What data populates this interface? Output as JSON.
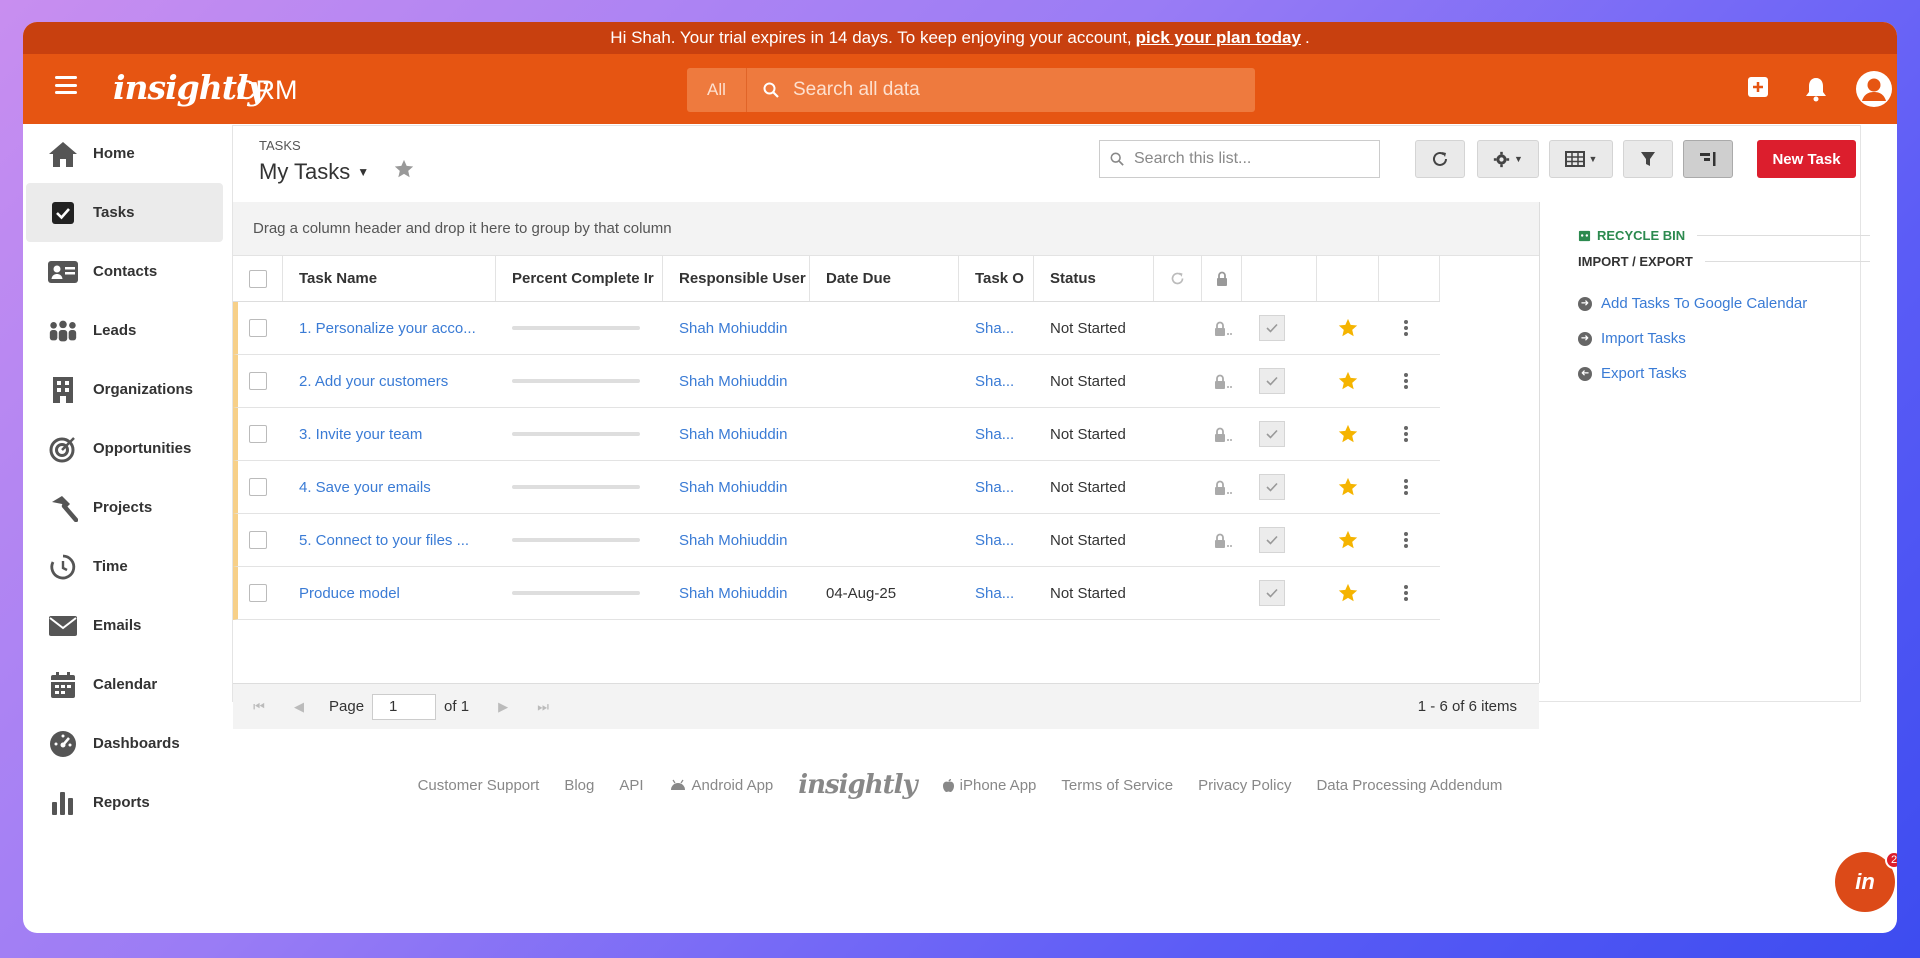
{
  "trial_banner": {
    "text": "Hi Shah. Your trial expires in 14 days. To keep enjoying your account,",
    "link": "pick your plan today",
    "suffix": "."
  },
  "topbar": {
    "logo": "insightly",
    "product": "CRM",
    "search_scope": "All",
    "search_placeholder": "Search all data",
    "icons": [
      "menu-icon",
      "add-icon",
      "bell-icon",
      "user-avatar-icon"
    ],
    "brand_color": "#e65512"
  },
  "sidebar": {
    "items": [
      {
        "label": "Home",
        "icon": "home-icon"
      },
      {
        "label": "Tasks",
        "icon": "checkbox-icon",
        "active": true
      },
      {
        "label": "Contacts",
        "icon": "contact-card-icon"
      },
      {
        "label": "Leads",
        "icon": "people-group-icon"
      },
      {
        "label": "Organizations",
        "icon": "building-icon"
      },
      {
        "label": "Opportunities",
        "icon": "target-icon"
      },
      {
        "label": "Projects",
        "icon": "hammer-icon"
      },
      {
        "label": "Time",
        "icon": "timer-icon"
      },
      {
        "label": "Emails",
        "icon": "envelope-icon"
      },
      {
        "label": "Calendar",
        "icon": "calendar-icon"
      },
      {
        "label": "Dashboards",
        "icon": "dashboard-gauge-icon"
      },
      {
        "label": "Reports",
        "icon": "bar-chart-icon"
      }
    ]
  },
  "header": {
    "section_label": "TASKS",
    "view_title": "My Tasks",
    "list_search_placeholder": "Search this list...",
    "new_task_label": "New Task"
  },
  "grid": {
    "group_hint": "Drag a column header and drop it here to group by that column",
    "columns": [
      "Task Name",
      "Percent Complete Ir",
      "Responsible User",
      "Date Due",
      "Task O",
      "Status"
    ],
    "rows": [
      {
        "name": "1. Personalize your acco...",
        "percent": 0,
        "user": "Shah Mohiuddin",
        "due": "",
        "owner": "Sha...",
        "status": "Not Started",
        "locked": true
      },
      {
        "name": "2. Add your customers",
        "percent": 0,
        "user": "Shah Mohiuddin",
        "due": "",
        "owner": "Sha...",
        "status": "Not Started",
        "locked": true
      },
      {
        "name": "3. Invite your team",
        "percent": 0,
        "user": "Shah Mohiuddin",
        "due": "",
        "owner": "Sha...",
        "status": "Not Started",
        "locked": true
      },
      {
        "name": "4. Save your emails",
        "percent": 0,
        "user": "Shah Mohiuddin",
        "due": "",
        "owner": "Sha...",
        "status": "Not Started",
        "locked": true
      },
      {
        "name": "5. Connect to your files ...",
        "percent": 0,
        "user": "Shah Mohiuddin",
        "due": "",
        "owner": "Sha...",
        "status": "Not Started",
        "locked": true
      },
      {
        "name": "Produce model",
        "percent": 0,
        "user": "Shah Mohiuddin",
        "due": "04-Aug-25",
        "owner": "Sha...",
        "status": "Not Started",
        "locked": false
      }
    ],
    "pager": {
      "page_label": "Page",
      "page_value": "1",
      "of_label": "of 1",
      "info": "1 - 6 of 6 items"
    }
  },
  "right_panel": {
    "recycle_bin": "RECYCLE BIN",
    "import_export": "IMPORT / EXPORT",
    "links": [
      "Add Tasks To Google Calendar",
      "Import Tasks",
      "Export Tasks"
    ]
  },
  "footer": {
    "links": [
      "Customer Support",
      "Blog",
      "API",
      "Android App",
      "insightly",
      "iPhone App",
      "Terms of Service",
      "Privacy Policy",
      "Data Processing Addendum"
    ]
  },
  "chat": {
    "label": "in",
    "badge": "2"
  },
  "colors": {
    "accent_link": "#3a7bd5",
    "new_task": "#dc1e2d",
    "star": "#f5b400",
    "recycle_green": "#2c8a4f"
  }
}
